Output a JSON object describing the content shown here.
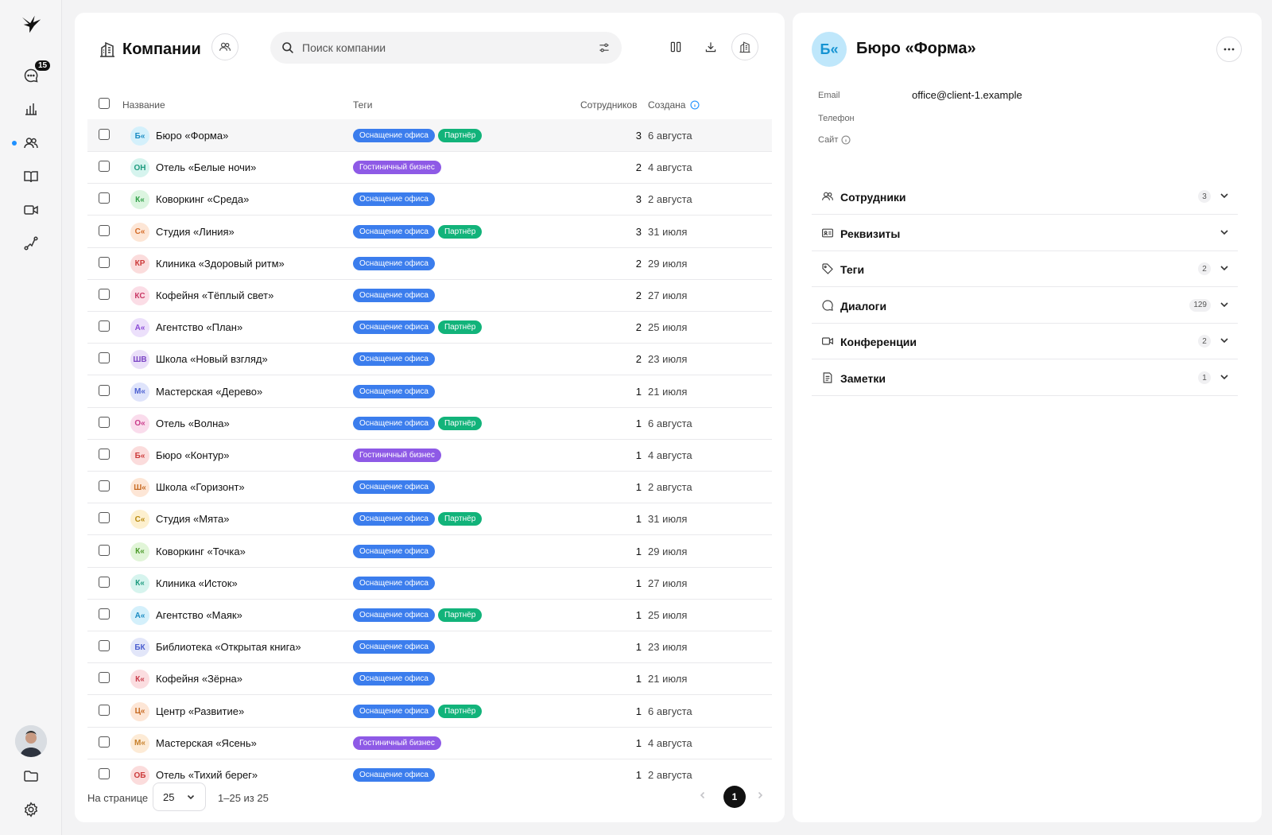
{
  "nav": {
    "messages_badge": "15"
  },
  "page": {
    "title": "Компании",
    "search_placeholder": "Поиск компании"
  },
  "table": {
    "headers": {
      "name": "Название",
      "tags": "Теги",
      "employees": "Сотрудников",
      "created": "Создана"
    },
    "rows": [
      {
        "initials": "Б«",
        "name": "Бюро «Форма»",
        "tags": [
          "Оснащение офиса",
          "Партнёр"
        ],
        "employees": "3",
        "created": "6 августа",
        "av_bg": "#d4f0fb",
        "av_fg": "#1a8bc2"
      },
      {
        "initials": "ОН",
        "name": "Отель «Белые ночи»",
        "tags": [
          "Гостиничный бизнес"
        ],
        "employees": "2",
        "created": "4 августа",
        "av_bg": "#d6f4ee",
        "av_fg": "#1e9b7f"
      },
      {
        "initials": "К«",
        "name": "Коворкинг «Среда»",
        "tags": [
          "Оснащение офиса"
        ],
        "employees": "3",
        "created": "2 августа",
        "av_bg": "#dcf5e0",
        "av_fg": "#2f9f46"
      },
      {
        "initials": "С«",
        "name": "Студия «Линия»",
        "tags": [
          "Оснащение офиса",
          "Партнёр"
        ],
        "employees": "3",
        "created": "31 июля",
        "av_bg": "#fde6d6",
        "av_fg": "#d46a25"
      },
      {
        "initials": "КР",
        "name": "Клиника «Здоровый ритм»",
        "tags": [
          "Оснащение офиса"
        ],
        "employees": "2",
        "created": "29 июля",
        "av_bg": "#fbdcdc",
        "av_fg": "#cc3b3b"
      },
      {
        "initials": "КС",
        "name": "Кофейня «Тёплый свет»",
        "tags": [
          "Оснащение офиса"
        ],
        "employees": "2",
        "created": "27 июля",
        "av_bg": "#fbdde6",
        "av_fg": "#c93966"
      },
      {
        "initials": "А«",
        "name": "Агентство «План»",
        "tags": [
          "Оснащение офиса",
          "Партнёр"
        ],
        "employees": "2",
        "created": "25 июля",
        "av_bg": "#ece0fb",
        "av_fg": "#8a4ad6"
      },
      {
        "initials": "ШВ",
        "name": "Школа «Новый взгляд»",
        "tags": [
          "Оснащение офиса"
        ],
        "employees": "2",
        "created": "23 июля",
        "av_bg": "#eadff9",
        "av_fg": "#7b44c4"
      },
      {
        "initials": "М«",
        "name": "Мастерская «Дерево»",
        "tags": [
          "Оснащение офиса"
        ],
        "employees": "1",
        "created": "21 июля",
        "av_bg": "#dfe4fb",
        "av_fg": "#4b5fd0"
      },
      {
        "initials": "О«",
        "name": "Отель «Волна»",
        "tags": [
          "Оснащение офиса",
          "Партнёр"
        ],
        "employees": "1",
        "created": "6 августа",
        "av_bg": "#fadcec",
        "av_fg": "#c93b8a"
      },
      {
        "initials": "Б«",
        "name": "Бюро «Контур»",
        "tags": [
          "Гостиничный бизнес"
        ],
        "employees": "1",
        "created": "4 августа",
        "av_bg": "#fbdcdc",
        "av_fg": "#cc3b3b"
      },
      {
        "initials": "Ш«",
        "name": "Школа «Горизонт»",
        "tags": [
          "Оснащение офиса"
        ],
        "employees": "1",
        "created": "2 августа",
        "av_bg": "#fde6d6",
        "av_fg": "#c76a22"
      },
      {
        "initials": "С«",
        "name": "Студия «Мята»",
        "tags": [
          "Оснащение офиса",
          "Партнёр"
        ],
        "employees": "1",
        "created": "31 июля",
        "av_bg": "#fdf0cf",
        "av_fg": "#b98a10"
      },
      {
        "initials": "К«",
        "name": "Коворкинг «Точка»",
        "tags": [
          "Оснащение офиса"
        ],
        "employees": "1",
        "created": "29 июля",
        "av_bg": "#e1f5d8",
        "av_fg": "#4c9a2a"
      },
      {
        "initials": "К«",
        "name": "Клиника «Исток»",
        "tags": [
          "Оснащение офиса"
        ],
        "employees": "1",
        "created": "27 июля",
        "av_bg": "#d6f4ee",
        "av_fg": "#1e9b7f"
      },
      {
        "initials": "А«",
        "name": "Агентство «Маяк»",
        "tags": [
          "Оснащение офиса",
          "Партнёр"
        ],
        "employees": "1",
        "created": "25 июля",
        "av_bg": "#d4f0fb",
        "av_fg": "#1a8bc2"
      },
      {
        "initials": "БК",
        "name": "Библиотека «Открытая книга»",
        "tags": [
          "Оснащение офиса"
        ],
        "employees": "1",
        "created": "23 июля",
        "av_bg": "#e2e6f9",
        "av_fg": "#4b5fd0"
      },
      {
        "initials": "К«",
        "name": "Кофейня «Зёрна»",
        "tags": [
          "Оснащение офиса"
        ],
        "employees": "1",
        "created": "21 июля",
        "av_bg": "#fbdde0",
        "av_fg": "#c93b4a"
      },
      {
        "initials": "Ц«",
        "name": "Центр «Развитие»",
        "tags": [
          "Оснащение офиса",
          "Партнёр"
        ],
        "employees": "1",
        "created": "6 августа",
        "av_bg": "#fde6d6",
        "av_fg": "#c76a22"
      },
      {
        "initials": "М«",
        "name": "Мастерская «Ясень»",
        "tags": [
          "Гостиничный бизнес"
        ],
        "employees": "1",
        "created": "4 августа",
        "av_bg": "#fdebd6",
        "av_fg": "#c7802a"
      },
      {
        "initials": "ОБ",
        "name": "Отель «Тихий берег»",
        "tags": [
          "Оснащение офиса"
        ],
        "employees": "1",
        "created": "2 августа",
        "av_bg": "#fbdcdc",
        "av_fg": "#cc3b3b"
      }
    ]
  },
  "pagination": {
    "per_page_label": "На странице",
    "per_page_value": "25",
    "range": "1–25 из 25",
    "current_page": "1"
  },
  "detail": {
    "initials": "Б«",
    "name": "Бюро «Форма»",
    "fields": {
      "email_label": "Email",
      "email_value": "office@client-1.example",
      "phone_label": "Телефон",
      "site_label": "Сайт"
    },
    "sections": [
      {
        "label": "Сотрудники",
        "count": "3",
        "icon": "users-icon"
      },
      {
        "label": "Реквизиты",
        "count": "",
        "icon": "id-card-icon"
      },
      {
        "label": "Теги",
        "count": "2",
        "icon": "tag-icon"
      },
      {
        "label": "Диалоги",
        "count": "129",
        "icon": "chat-icon"
      },
      {
        "label": "Конференции",
        "count": "2",
        "icon": "video-icon"
      },
      {
        "label": "Заметки",
        "count": "1",
        "icon": "note-icon"
      }
    ]
  },
  "colors": {
    "tag_office": "#3b7ded",
    "tag_partner": "#12b37a",
    "tag_hotel": "#8e5ae6",
    "accent": "#1e90ff"
  }
}
